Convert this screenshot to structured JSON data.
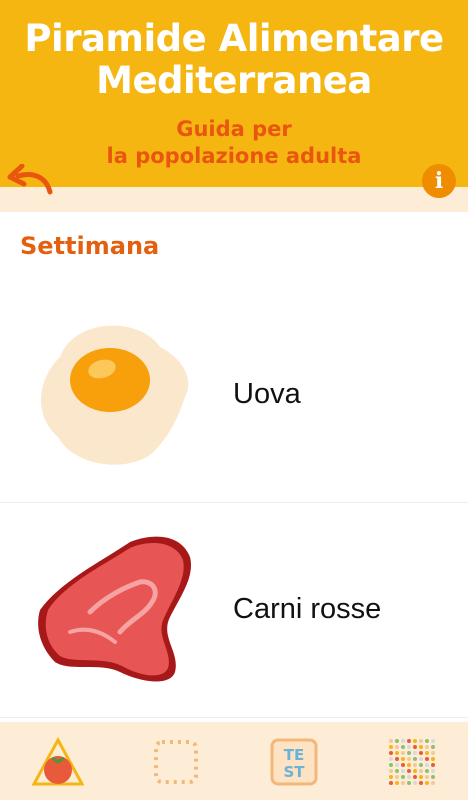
{
  "header": {
    "title_line1": "Piramide Alimentare",
    "title_line2": "Mediterranea",
    "subtitle_line1": "Guida per",
    "subtitle_line2": "la popolazione adulta"
  },
  "section": {
    "title": "Settimana"
  },
  "items": [
    {
      "label": "Uova",
      "icon": "egg-icon"
    },
    {
      "label": "Carni rosse",
      "icon": "red-meat-icon"
    }
  ],
  "info": {
    "label": "i"
  },
  "bottom_nav": [
    {
      "icon": "pyramid-tomato-icon"
    },
    {
      "icon": "dotted-square-icon"
    },
    {
      "icon": "test-icon",
      "label_line1": "TE",
      "label_line2": "ST"
    },
    {
      "icon": "dot-grid-icon"
    }
  ],
  "colors": {
    "header_bg": "#f6b612",
    "accent_orange": "#e8560f",
    "band_bg": "#fdecd6"
  }
}
